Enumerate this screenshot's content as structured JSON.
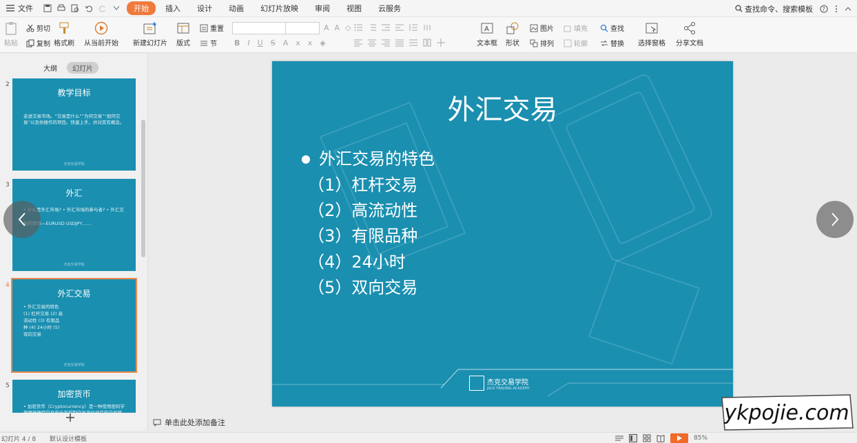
{
  "menu": {
    "file": "文件",
    "tabs": [
      "开始",
      "插入",
      "设计",
      "动画",
      "幻灯片放映",
      "审阅",
      "视图",
      "云服务"
    ],
    "search": "查找命令、搜索模板"
  },
  "ribbon": {
    "cut": "剪切",
    "copy": "复制",
    "format_painter": "格式刷",
    "paste": "粘贴",
    "from_current": "从当前开始",
    "new_slide": "新建幻灯片",
    "layout": "版式",
    "reset": "重置",
    "section": "节",
    "textbox": "文本框",
    "shape": "形状",
    "picture": "图片",
    "arrange": "排列",
    "find": "查找",
    "replace": "替换",
    "select_pane": "选择窗格",
    "share": "分享文档",
    "fill": "填充",
    "outline": "轮廓"
  },
  "panel": {
    "tab_outline": "大纲",
    "tab_slides": "幻灯片"
  },
  "thumbs": [
    {
      "num": "2",
      "title": "教学目标",
      "body": "走进交易市场。“交易是什么”“为何交易”“如何交易”以及你操作的项目。快速上手，并对其有概念。"
    },
    {
      "num": "3",
      "title": "外汇",
      "body": "• 什么是外汇市场?  • 外汇市场的参与者?  • 外汇交易的货币—EURUSD USDJPY……"
    },
    {
      "num": "4",
      "title": "外汇交易",
      "body": "• 外汇交易的特色  (1) 杠杆交易  (2) 高流动性  (3) 有限品种  (4) 24小时  (5) 双向交易"
    },
    {
      "num": "5",
      "title": "加密货币",
      "body": "• 加密货币（Cryptocurrency）是一种使用密码学原理来确保交易安全及控制交易单位创造的交易媒介。"
    }
  ],
  "thumb_footer": "杰克交易学院",
  "slide": {
    "title": "外汇交易",
    "bullet": "外汇交易的特色",
    "items": [
      "（1）杠杆交易",
      "（2）高流动性",
      "（3）有限品种",
      "（4）24小时",
      "（5）双向交易"
    ],
    "logo_cn": "杰克交易学院",
    "logo_en": "JACK TRADING ACADEMY"
  },
  "notes_placeholder": "单击此处添加备注",
  "status": {
    "slide_counter": "幻灯片 4 / 8",
    "theme": "默认设计模板",
    "zoom": "85%"
  },
  "watermark": "ykpojie.com",
  "colors": {
    "accent": "#f07a3c",
    "slide_bg": "#1a8fb0"
  }
}
